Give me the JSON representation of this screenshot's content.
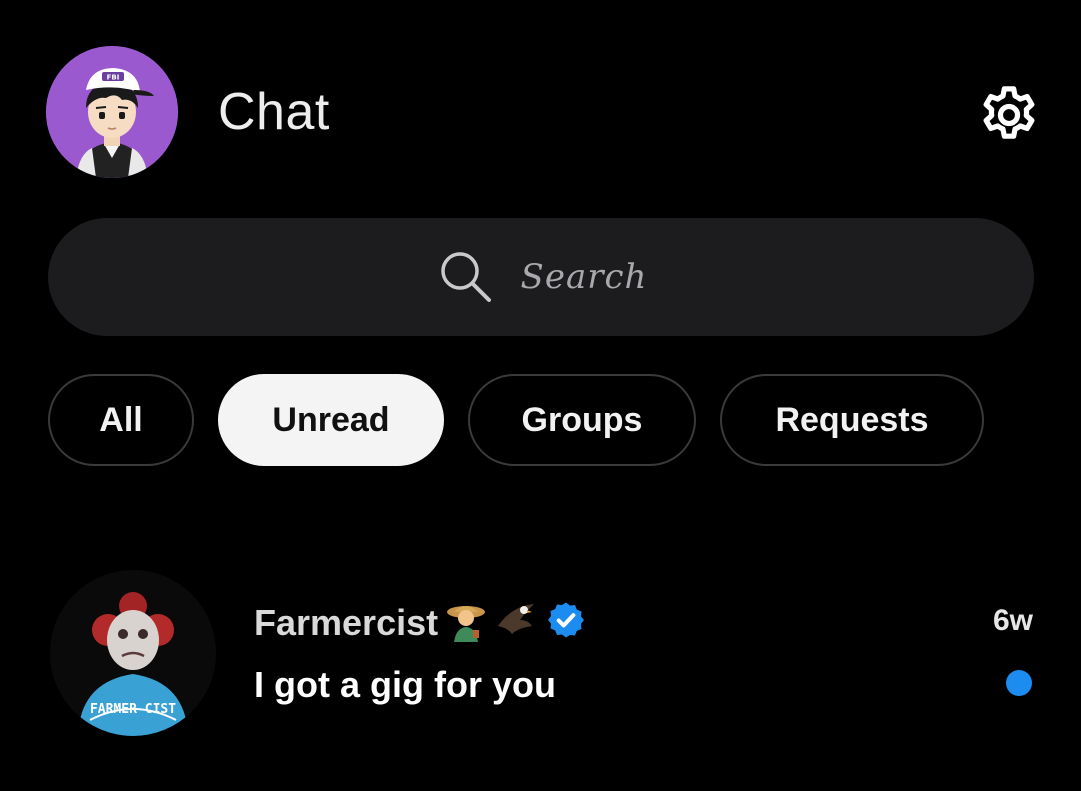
{
  "header": {
    "title": "Chat",
    "profile_badge": "FBI"
  },
  "search": {
    "placeholder": "Search"
  },
  "filters": [
    {
      "label": "All",
      "active": false
    },
    {
      "label": "Unread",
      "active": true
    },
    {
      "label": "Groups",
      "active": false
    },
    {
      "label": "Requests",
      "active": false
    }
  ],
  "conversations": [
    {
      "name": "Farmercist",
      "name_emojis": [
        "farmer-emoji",
        "eagle-emoji"
      ],
      "verified": true,
      "message": "I got a gig for you",
      "time": "6w",
      "unread": true,
      "avatar_text": "FARMER CIST"
    }
  ],
  "colors": {
    "background": "#000000",
    "search_bg": "#1c1c1e",
    "chip_border": "#3a3a3c",
    "chip_active_bg": "#f4f4f4",
    "accent_blue": "#1d8cf0",
    "profile_avatar_bg": "#9b59d0"
  },
  "icons": {
    "settings": "gear-icon",
    "search": "search-icon",
    "verified": "verified-badge-icon"
  }
}
